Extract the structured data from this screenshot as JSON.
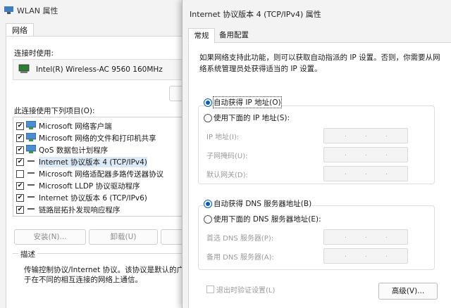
{
  "wlan": {
    "title": "WLAN 属性",
    "tab_network": "网络",
    "connect_using_label": "连接时使用:",
    "adapter_name": "Intel(R) Wireless-AC 9560 160MHz",
    "items_label": "此连接使用下列项目(O):",
    "items": [
      {
        "label": "Microsoft 网络客户端",
        "checked": true,
        "icon": "network-client-icon"
      },
      {
        "label": "Microsoft 网络的文件和打印机共享",
        "checked": true,
        "icon": "file-share-icon"
      },
      {
        "label": "QoS 数据包计划程序",
        "checked": true,
        "icon": "qos-icon"
      },
      {
        "label": "Internet 协议版本 4 (TCP/IPv4)",
        "checked": true,
        "icon": "protocol-icon",
        "selected": true
      },
      {
        "label": "Microsoft 网络适配器多路传送器协议",
        "checked": false,
        "icon": "protocol-icon"
      },
      {
        "label": "Microsoft LLDP 协议驱动程序",
        "checked": true,
        "icon": "protocol-icon"
      },
      {
        "label": "Internet 协议版本 6 (TCP/IPv6)",
        "checked": true,
        "icon": "protocol-icon"
      },
      {
        "label": "链路层拓扑发现响应程序",
        "checked": true,
        "icon": "protocol-icon"
      }
    ],
    "install_btn": "安装(N)...",
    "uninstall_btn": "卸载(U)",
    "desc_title": "描述",
    "desc_line1": "传输控制协议/Internet 协议。该协议是默认的广域网",
    "desc_line2": "于在不同的相互连接的网络上通信。"
  },
  "ipv4": {
    "title": "Internet 协议版本 4 (TCP/IPv4) 属性",
    "tab_general": "常规",
    "tab_alternate": "备用配置",
    "intro_line1": "如果网络支持此功能，则可以获取自动指派的 IP 设置。否则，你需要从网",
    "intro_line2": "络系统管理员处获得适当的 IP 设置。",
    "auto_ip": "自动获得 IP 地址(O)",
    "manual_ip": "使用下面的 IP 地址(S):",
    "ip_address": "IP 地址(I):",
    "subnet": "子网掩码(U):",
    "gateway": "默认网关(D):",
    "auto_dns": "自动获得 DNS 服务器地址(B)",
    "manual_dns": "使用下面的 DNS 服务器地址(E):",
    "preferred_dns": "首选 DNS 服务器(P):",
    "alternate_dns": "备用 DNS 服务器(A):",
    "validate_on_exit": "退出时验证设置(L)",
    "advanced_btn": "高级(V)...",
    "ip_dots": ".",
    "auto_ip_selected": true,
    "auto_dns_selected": true
  },
  "colors": {
    "accent": "#0b5cad",
    "selection": "#dce9f7",
    "disabled_text": "#9a9a9a"
  }
}
